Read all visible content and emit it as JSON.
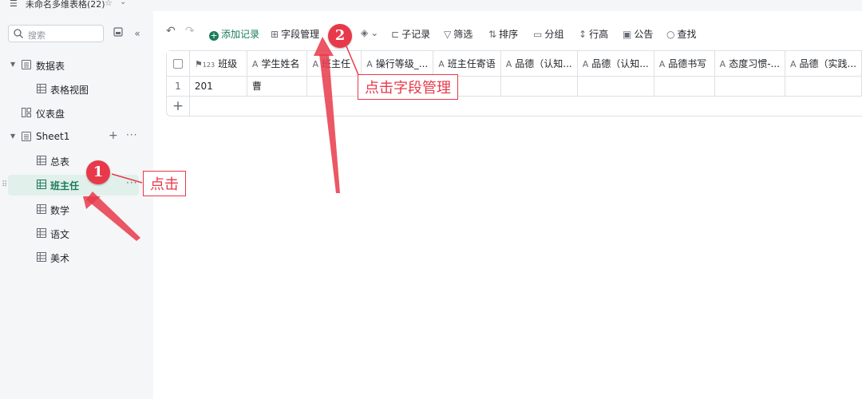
{
  "window": {
    "title": "未命名多维表格(22)"
  },
  "sidebar": {
    "search_placeholder": "搜索",
    "items": [
      {
        "label": "数据表"
      },
      {
        "label": "表格视图"
      },
      {
        "label": "仪表盘"
      },
      {
        "label": "Sheet1"
      },
      {
        "label": "总表"
      },
      {
        "label": "班主任"
      },
      {
        "label": "数学"
      },
      {
        "label": "语文"
      },
      {
        "label": "美术"
      }
    ]
  },
  "toolbar": {
    "add_record": "添加记录",
    "field_manage": "字段管理",
    "sub_record": "子记录",
    "filter": "筛选",
    "sort": "排序",
    "group": "分组",
    "row_height": "行高",
    "notice": "公告",
    "find": "查找"
  },
  "grid": {
    "columns": [
      {
        "label": "班级",
        "type_icon": "123"
      },
      {
        "label": "学生姓名",
        "type_icon": "A"
      },
      {
        "label": "班主任",
        "type_icon": "A"
      },
      {
        "label": "操行等级_...",
        "type_icon": "A"
      },
      {
        "label": "班主任寄语",
        "type_icon": "A"
      },
      {
        "label": "品德（认知...",
        "type_icon": "A"
      },
      {
        "label": "品德（认知...",
        "type_icon": "A"
      },
      {
        "label": "品德书写",
        "type_icon": "A"
      },
      {
        "label": "态度习惯-...",
        "type_icon": "A"
      },
      {
        "label": "品德（实践...",
        "type_icon": "A"
      }
    ],
    "rows": [
      {
        "num": "1",
        "class": "201",
        "student": "曹"
      }
    ]
  },
  "annotations": {
    "badge1": "1",
    "badge2": "2",
    "callout1": "点击",
    "callout2": "点击字段管理"
  },
  "colors": {
    "accent": "#1a7a5c",
    "annotation": "#e8394a"
  }
}
